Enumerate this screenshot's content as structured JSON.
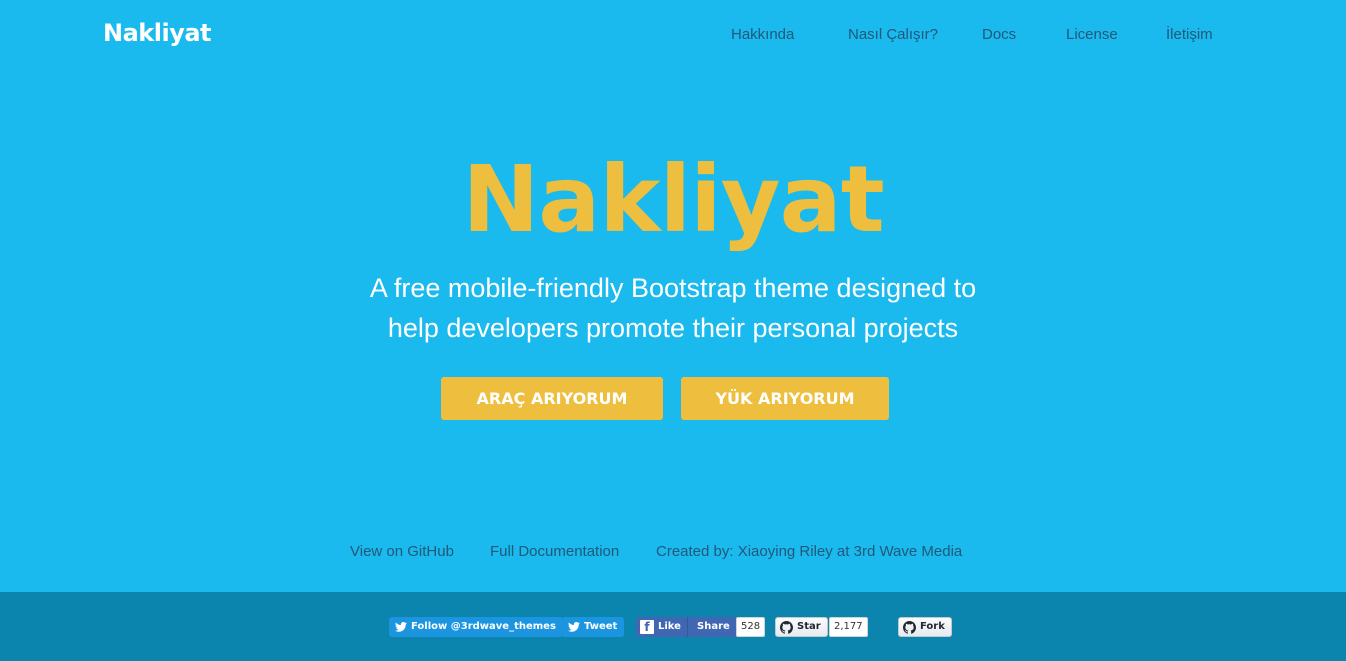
{
  "brand": "Nakliyat",
  "nav": [
    {
      "label": "Hakkında"
    },
    {
      "label": "Nasıl Çalışır?"
    },
    {
      "label": "Docs"
    },
    {
      "label": "License"
    },
    {
      "label": "İletişim"
    }
  ],
  "hero": {
    "title": "Nakliyat",
    "tagline_line1": "A free mobile-friendly Bootstrap theme designed to",
    "tagline_line2": "help developers promote their personal projects",
    "cta_vehicle": "ARAÇ ARIYORUM",
    "cta_load": "YÜK ARIYORUM"
  },
  "links": [
    {
      "label": "View on GitHub"
    },
    {
      "label": "Full Documentation"
    },
    {
      "label": "Created by: Xiaoying Riley at 3rd Wave Media"
    }
  ],
  "social": {
    "twitter_follow": "Follow @3rdwave_themes",
    "twitter_tweet": "Tweet",
    "fb_like": "Like",
    "fb_share": "Share",
    "fb_count": "528",
    "gh_star": "Star",
    "gh_star_count": "2,177",
    "gh_fork": "Fork"
  },
  "colors": {
    "background": "#1ab9ee",
    "accent": "#eebf3e",
    "footer": "#0c85ae",
    "nav_text": "#20597a"
  }
}
